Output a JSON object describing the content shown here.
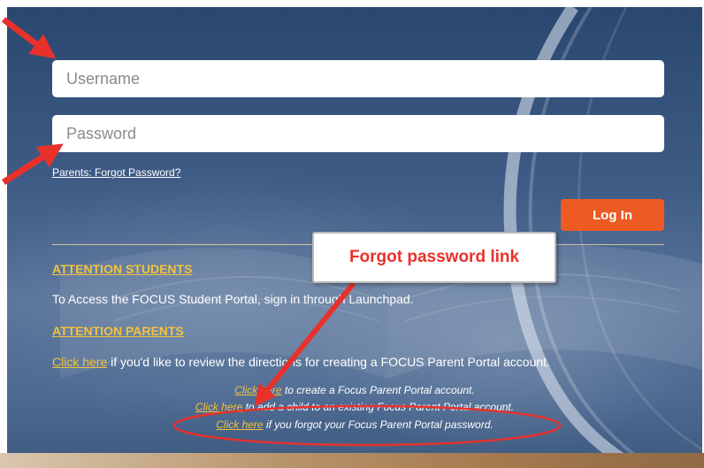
{
  "form": {
    "username_placeholder": "Username",
    "password_placeholder": "Password",
    "forgot_password_small": "Parents: Forgot Password?",
    "login_label": "Log In"
  },
  "notices": {
    "students_heading": "ATTENTION STUDENTS",
    "students_text": "To Access the FOCUS Student Portal, sign in through Launchpad.",
    "parents_heading": "ATTENTION PARENTS",
    "parents_link": "Click here",
    "parents_text": " if you'd like to review the directions for creating a FOCUS Parent Portal account."
  },
  "links": {
    "line1_link": "Click here",
    "line1_text": " to create a Focus Parent Portal account.",
    "line2_link": "Click here",
    "line2_text": " to add a child to an existing Focus Parent Portal account.",
    "line3_link": "Click here",
    "line3_text": " if you forgot your Focus Parent Portal password."
  },
  "annotation": {
    "callout_text": "Forgot password link"
  },
  "colors": {
    "login_button": "#ee5a24",
    "heading_gold": "#f4c23e",
    "annotation_red": "#e8312b"
  }
}
